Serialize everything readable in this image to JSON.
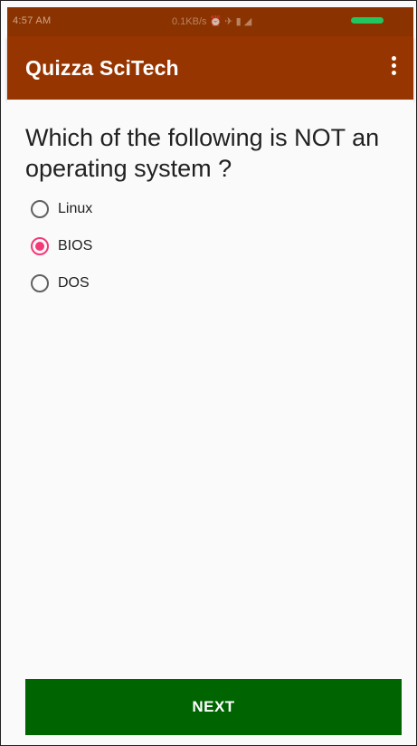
{
  "status_bar": {
    "time": "4:57 AM",
    "info": "0.1KB/s ⏰ ✈ ▮ ◢",
    "background": "#8a3300",
    "battery_color": "#22c55e"
  },
  "app_bar": {
    "title": "Quizza SciTech",
    "background": "#963500",
    "menu_icon": "more-vert-icon"
  },
  "question": {
    "text": "Which of the following is NOT an operating system ?"
  },
  "options": [
    {
      "label": "Linux",
      "selected": false
    },
    {
      "label": "BIOS",
      "selected": true
    },
    {
      "label": "DOS",
      "selected": false
    }
  ],
  "accent_color": "#f4397a",
  "next_button": {
    "label": "NEXT",
    "background": "#006400"
  }
}
